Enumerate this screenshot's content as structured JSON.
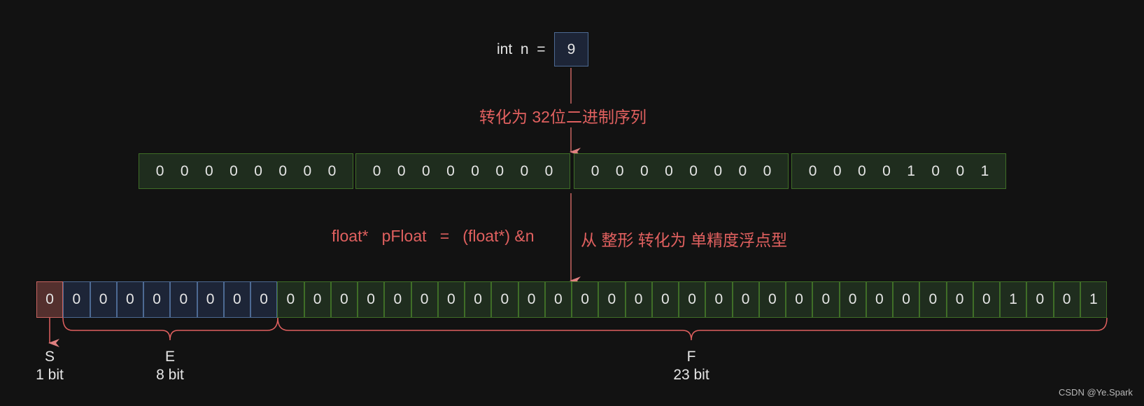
{
  "declaration": {
    "label": "int  n  =",
    "value": "9"
  },
  "step1": {
    "label": "转化为 32位二进制序列"
  },
  "int_bytes": [
    [
      "0",
      "0",
      "0",
      "0",
      "0",
      "0",
      "0",
      "0"
    ],
    [
      "0",
      "0",
      "0",
      "0",
      "0",
      "0",
      "0",
      "0"
    ],
    [
      "0",
      "0",
      "0",
      "0",
      "0",
      "0",
      "0",
      "0"
    ],
    [
      "0",
      "0",
      "0",
      "0",
      "1",
      "0",
      "0",
      "1"
    ]
  ],
  "step2": {
    "code": "float*   pFloat   =   (float*) &n",
    "label": "从 整形 转化为 单精度浮点型"
  },
  "float_bits": {
    "sign": [
      "0"
    ],
    "exponent": [
      "0",
      "0",
      "0",
      "0",
      "0",
      "0",
      "0",
      "0"
    ],
    "fraction": [
      "0",
      "0",
      "0",
      "0",
      "0",
      "0",
      "0",
      "0",
      "0",
      "0",
      "0",
      "0",
      "0",
      "0",
      "0",
      "0",
      "0",
      "0",
      "0",
      "0",
      "0",
      "0",
      "0",
      "0",
      "0",
      "0",
      "0",
      "1",
      "0",
      "0",
      "1"
    ]
  },
  "segments": [
    {
      "name": "S",
      "size": "1 bit"
    },
    {
      "name": "E",
      "size": "8 bit"
    },
    {
      "name": "F",
      "size": "23 bit"
    }
  ],
  "colors": {
    "accent": "#e0605f",
    "sign": "#54302e",
    "exponent": "#1d2537",
    "fraction": "#1f2d1e"
  },
  "watermark": "CSDN @Ye.Spark"
}
